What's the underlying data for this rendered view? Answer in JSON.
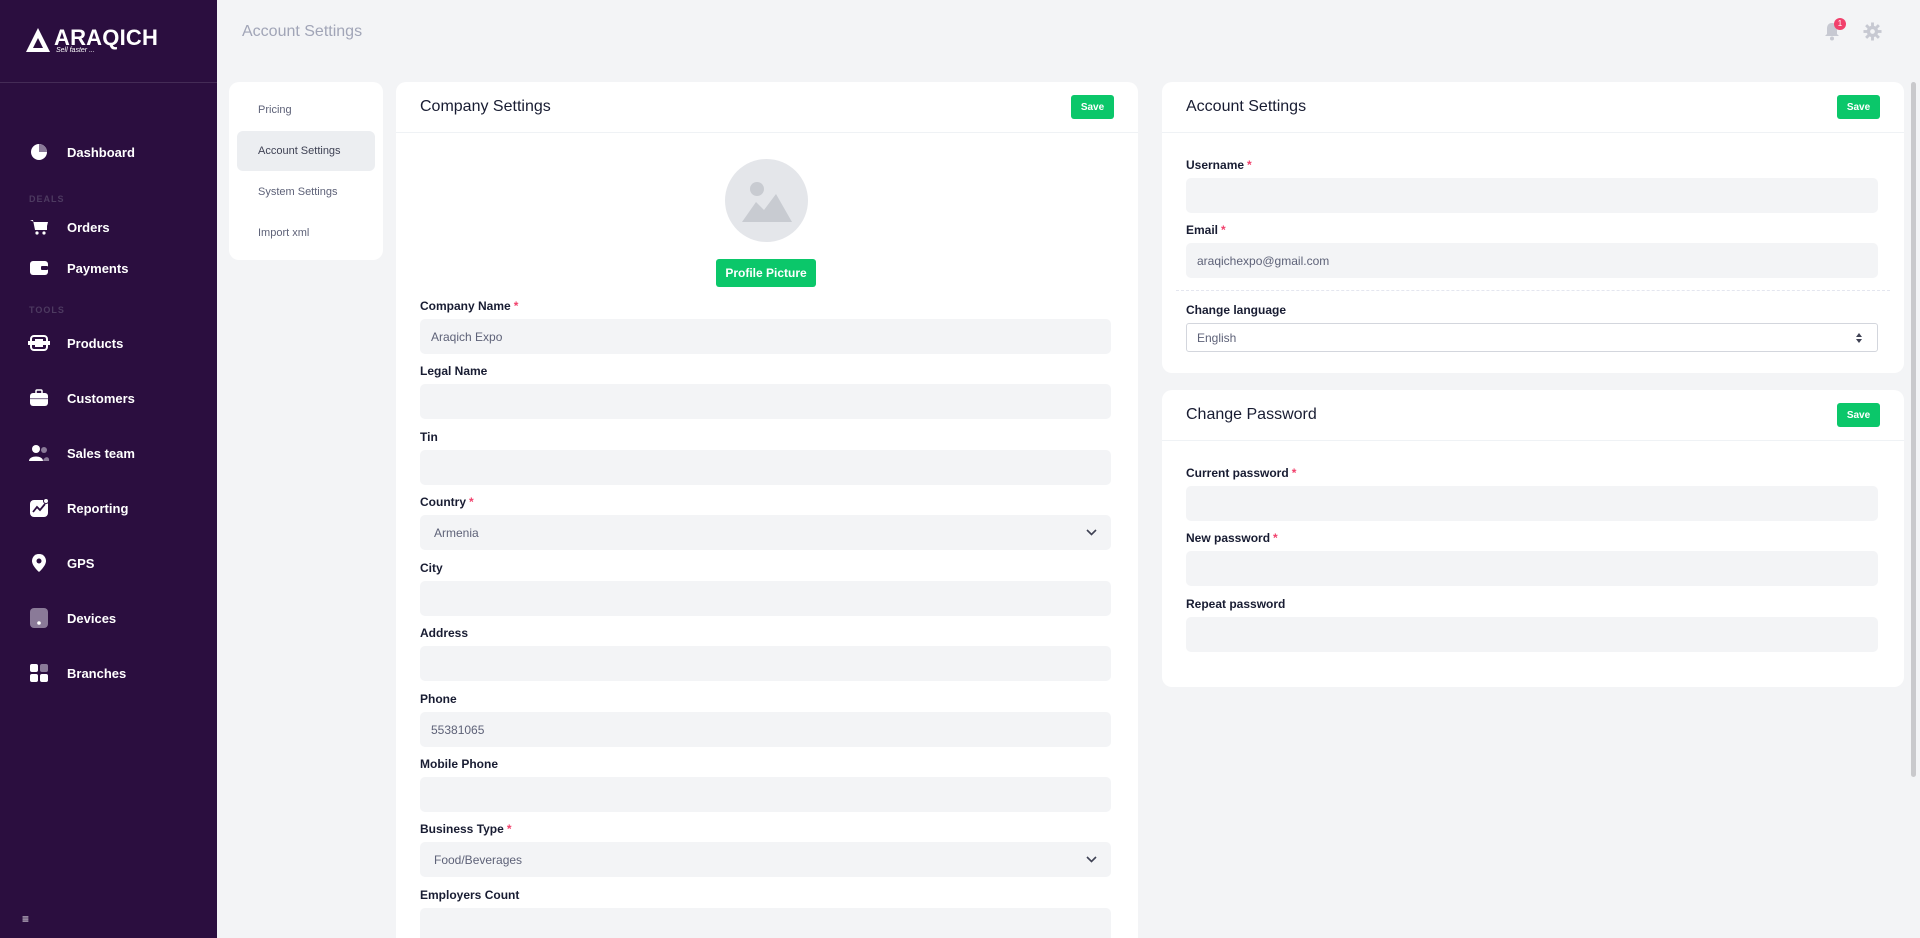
{
  "brand": {
    "name": "ARAQICH",
    "tagline": "Sell faster ..."
  },
  "colors": {
    "sidebar": "#2b0e3f",
    "accent": "#0bc76a",
    "required": "#f1416c",
    "background": "#f3f4f6"
  },
  "sidebar": {
    "items": [
      {
        "label": "Dashboard",
        "icon": "pie-chart-icon"
      },
      {
        "label": "Orders",
        "icon": "cart-icon"
      },
      {
        "label": "Payments",
        "icon": "wallet-icon"
      },
      {
        "label": "Products",
        "icon": "box-icon"
      },
      {
        "label": "Customers",
        "icon": "briefcase-icon"
      },
      {
        "label": "Sales team",
        "icon": "users-icon"
      },
      {
        "label": "Reporting",
        "icon": "chart-icon"
      },
      {
        "label": "GPS",
        "icon": "location-pin-icon"
      },
      {
        "label": "Devices",
        "icon": "device-icon"
      },
      {
        "label": "Branches",
        "icon": "grid-icon"
      }
    ],
    "sections": {
      "deals": "DEALS",
      "tools": "TOOLS"
    },
    "menu_icon": "≡"
  },
  "header": {
    "title": "Account Settings",
    "notification_count": "1"
  },
  "settings_nav": {
    "items": [
      {
        "label": "Pricing"
      },
      {
        "label": "Account Settings"
      },
      {
        "label": "System Settings"
      },
      {
        "label": "Import xml"
      }
    ]
  },
  "company": {
    "title": "Company Settings",
    "save": "Save",
    "profile_picture": "Profile Picture",
    "fields": {
      "company_name": {
        "label": "Company Name",
        "value": "Araqich Expo"
      },
      "legal_name": {
        "label": "Legal Name",
        "value": ""
      },
      "tin": {
        "label": "Tin",
        "value": ""
      },
      "country": {
        "label": "Country",
        "value": "Armenia"
      },
      "city": {
        "label": "City",
        "value": ""
      },
      "address": {
        "label": "Address",
        "value": ""
      },
      "phone": {
        "label": "Phone",
        "value": "55381065"
      },
      "mobile_phone": {
        "label": "Mobile Phone",
        "value": ""
      },
      "business_type": {
        "label": "Business Type",
        "value": "Food/Beverages"
      },
      "employers_count": {
        "label": "Employers Count",
        "value": ""
      }
    }
  },
  "account": {
    "title": "Account Settings",
    "save": "Save",
    "username": {
      "label": "Username",
      "value": ""
    },
    "email": {
      "label": "Email",
      "value": "araqichexpo@gmail.com"
    },
    "language": {
      "label": "Change language",
      "value": "English"
    }
  },
  "password": {
    "title": "Change Password",
    "save": "Save",
    "current": {
      "label": "Current password"
    },
    "new": {
      "label": "New password"
    },
    "repeat": {
      "label": "Repeat password"
    }
  },
  "required_mark": "*"
}
